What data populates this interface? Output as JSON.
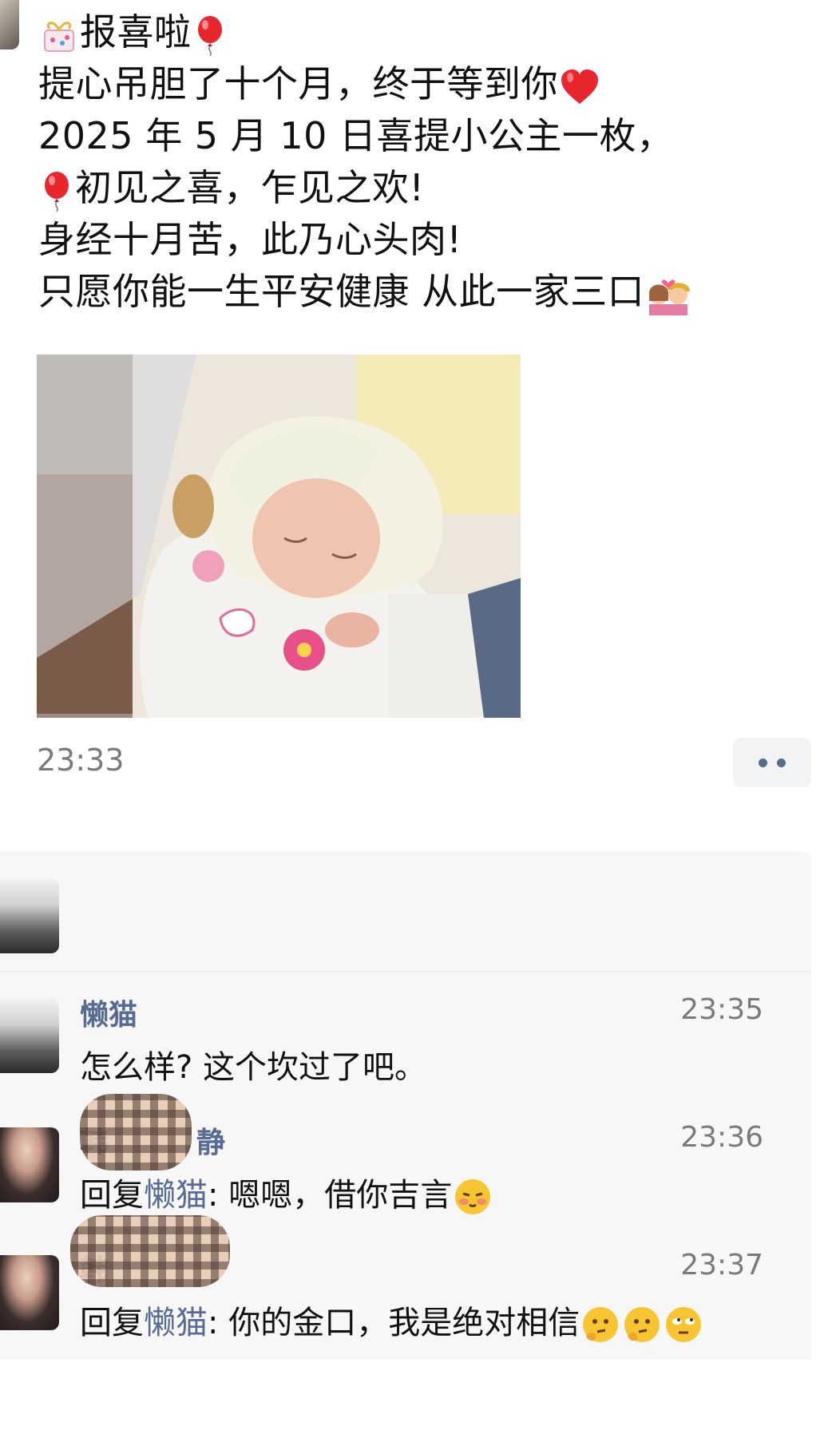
{
  "post": {
    "line1": "报喜啦",
    "line2": "提心吊胆了十个月，终于等到你",
    "line3": "2025 年 5 月 10 日喜提小公主一枚，",
    "line4": "初见之喜，乍见之欢!",
    "line5": "身经十月苦，此乃心头肉!",
    "line6": "只愿你能一生平安健康  从此一家三口",
    "time": "23:33"
  },
  "comments": [
    {
      "name": "懒猫",
      "time": "23:35",
      "text": "怎么样? 这个坎过了吧。"
    },
    {
      "name_visible": "韩",
      "name_visible_end": "静",
      "time": "23:36",
      "prefix": "回复",
      "reply_to": "懒猫",
      "text": ": 嗯嗯，借你吉言"
    },
    {
      "name_visible": "韩",
      "time": "23:37",
      "prefix": "回复",
      "reply_to": "懒猫",
      "text": ": 你的金口，我是绝对相信"
    }
  ],
  "icons": {
    "gift": "gift-icon",
    "balloon": "balloon-icon",
    "heart": "red-heart-icon",
    "family": "couple-heart-icon",
    "more": "more-dots-icon",
    "shy": "shy-face-icon",
    "thinking": "thinking-face-icon",
    "rolleyes": "rolling-eyes-face-icon"
  },
  "colors": {
    "link": "#576b95",
    "time": "#7a7a7a",
    "panel": "#f7f7f7"
  }
}
